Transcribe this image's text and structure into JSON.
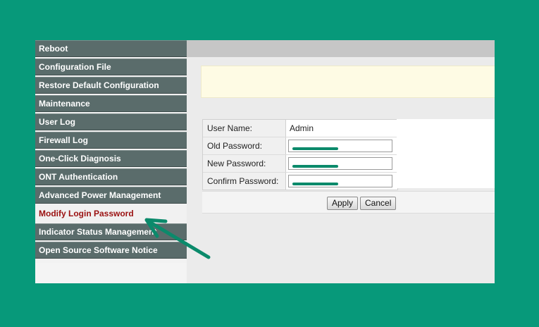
{
  "sidebar": {
    "items": [
      {
        "label": "Reboot"
      },
      {
        "label": "Configuration File"
      },
      {
        "label": "Restore Default Configuration"
      },
      {
        "label": "Maintenance"
      },
      {
        "label": "User Log"
      },
      {
        "label": "Firewall Log"
      },
      {
        "label": "One-Click Diagnosis"
      },
      {
        "label": "ONT Authentication"
      },
      {
        "label": "Advanced Power Management"
      },
      {
        "label": "Modify Login Password",
        "active": true
      },
      {
        "label": "Indicator Status Management"
      },
      {
        "label": "Open Source Software Notice"
      }
    ]
  },
  "form": {
    "user_name_label": "User Name:",
    "user_name_value": "Admin",
    "old_password_label": "Old Password:",
    "new_password_label": "New Password:",
    "confirm_password_label": "Confirm Password:"
  },
  "buttons": {
    "apply": "Apply",
    "cancel": "Cancel"
  },
  "colors": {
    "backdrop": "#07997a",
    "sidebar_item": "#5a6c6b",
    "active_text": "#9a1010",
    "annotation": "#0b8a6b"
  },
  "annotation": {
    "arrow_icon": "arrow-pointer-icon"
  }
}
